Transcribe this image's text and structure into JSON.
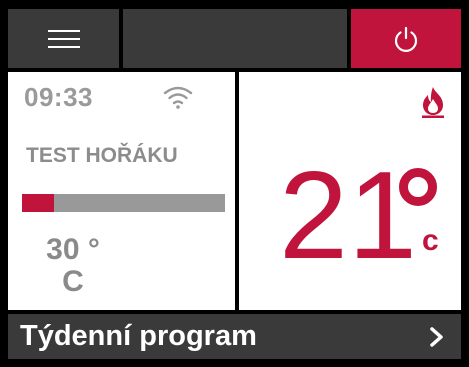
{
  "status": {
    "time": "09:33",
    "mode": "TEST HOŘÁKU",
    "progress": 0.16,
    "setpoint_value": "30 °",
    "setpoint_unit": "C"
  },
  "current": {
    "temperature": "21",
    "unit": "c"
  },
  "bottom": {
    "label": "Týdenní program"
  },
  "icons": {
    "menu": "hamburger-icon",
    "power": "power-icon",
    "wifi": "wifi-icon",
    "flame": "flame-icon",
    "chevron": "chevron-right-icon"
  },
  "colors": {
    "accent": "#c0143c",
    "bar": "#3a3a3a",
    "text_muted": "#8c8c8c"
  }
}
